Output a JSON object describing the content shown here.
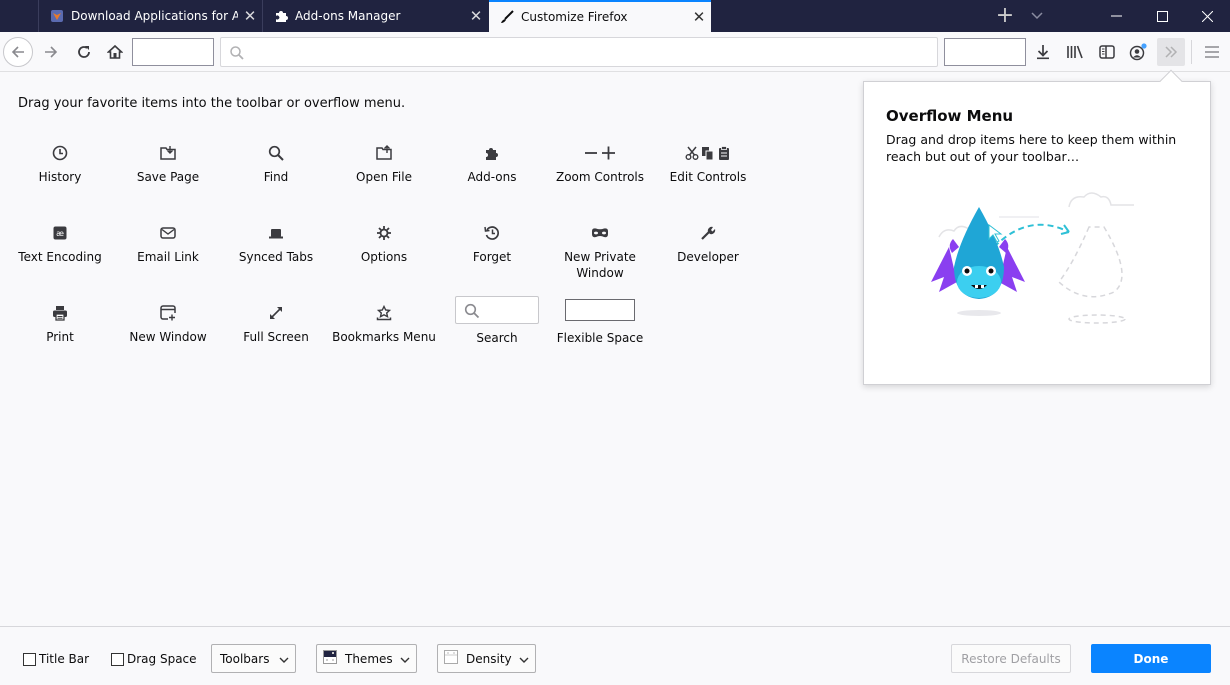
{
  "tabs": [
    {
      "label": "Download Applications for Android",
      "icon": "site-favicon-icon",
      "active": false
    },
    {
      "label": "Add-ons Manager",
      "icon": "puzzle-icon",
      "active": false
    },
    {
      "label": "Customize Firefox",
      "icon": "paintbrush-icon",
      "active": true
    }
  ],
  "window": {
    "close_tab_glyph": "✕",
    "new_tab_glyph": "+",
    "minimize_glyph": "—",
    "maximize_glyph": "☐",
    "close_glyph": "✕"
  },
  "navbar": {
    "urlbar_placeholder": ""
  },
  "instructions": "Drag your favorite items into the toolbar or overflow menu.",
  "palette": [
    {
      "label": "History",
      "icon": "clock-icon"
    },
    {
      "label": "Save Page",
      "icon": "save-page-icon"
    },
    {
      "label": "Find",
      "icon": "search-icon"
    },
    {
      "label": "Open File",
      "icon": "open-file-icon"
    },
    {
      "label": "Add-ons",
      "icon": "puzzle-icon"
    },
    {
      "label": "Zoom Controls",
      "icon": "zoom-icon"
    },
    {
      "label": "Edit Controls",
      "icon": "edit-controls-icon"
    },
    {
      "label": "Text Encoding",
      "icon": "text-encoding-icon"
    },
    {
      "label": "Email Link",
      "icon": "envelope-icon"
    },
    {
      "label": "Synced Tabs",
      "icon": "laptop-icon"
    },
    {
      "label": "Options",
      "icon": "gear-icon"
    },
    {
      "label": "Forget",
      "icon": "forget-icon"
    },
    {
      "label": "New Private Window",
      "icon": "mask-icon"
    },
    {
      "label": "Developer",
      "icon": "wrench-icon"
    },
    {
      "label": "Print",
      "icon": "printer-icon"
    },
    {
      "label": "New Window",
      "icon": "new-window-icon"
    },
    {
      "label": "Full Screen",
      "icon": "fullscreen-icon"
    },
    {
      "label": "Bookmarks Menu",
      "icon": "bookmark-star-icon"
    },
    {
      "label": "Search",
      "icon": "search-widget"
    },
    {
      "label": "Flexible Space",
      "icon": "flexible-space"
    }
  ],
  "overflow_panel": {
    "title": "Overflow Menu",
    "description": "Drag and drop items here to keep them within reach but out of your toolbar…"
  },
  "footer": {
    "title_bar": {
      "label": "Title Bar",
      "checked": false
    },
    "drag_space": {
      "label": "Drag Space",
      "checked": false
    },
    "toolbars": "Toolbars",
    "themes": "Themes",
    "density": "Density",
    "restore_defaults": "Restore Defaults",
    "done": "Done"
  },
  "colors": {
    "accent": "#0a84ff",
    "tabbar": "#202340",
    "dragon_body": "#1fa6d6",
    "dragon_wings": "#8a3ff0"
  }
}
